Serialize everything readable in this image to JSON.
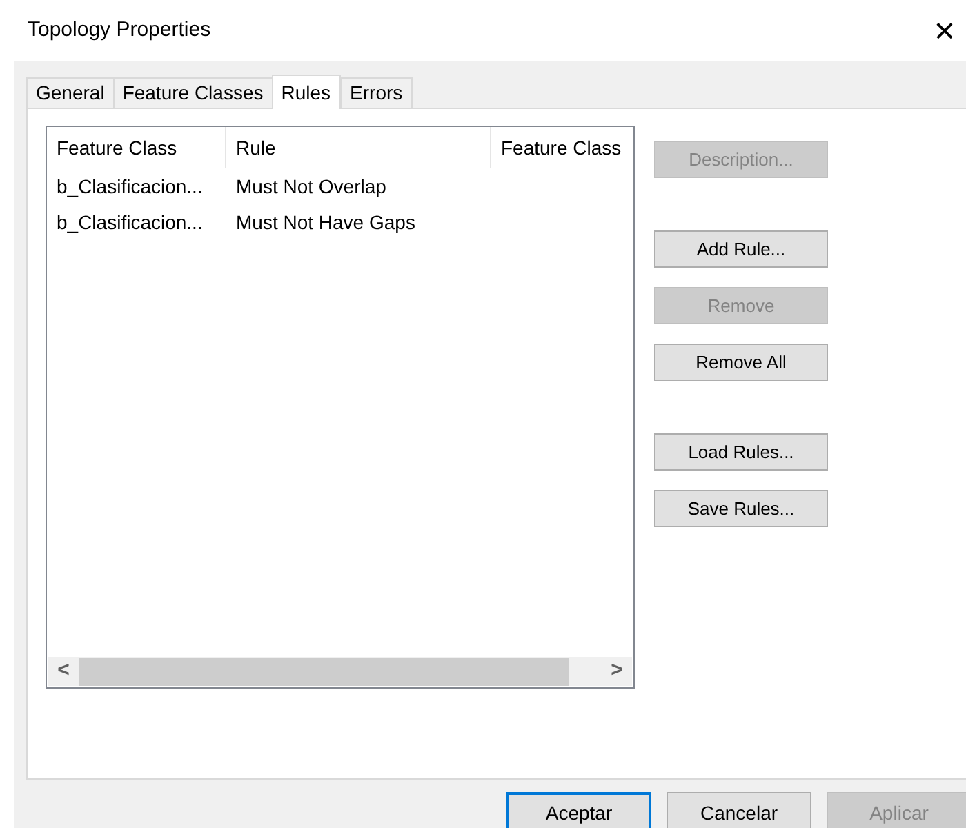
{
  "window": {
    "title": "Topology Properties",
    "close": "×"
  },
  "tabs": [
    {
      "label": "General",
      "selected": false
    },
    {
      "label": "Feature Classes",
      "selected": false
    },
    {
      "label": "Rules",
      "selected": true
    },
    {
      "label": "Errors",
      "selected": false
    }
  ],
  "table": {
    "columns": [
      "Feature Class",
      "Rule",
      "Feature Class"
    ],
    "rows": [
      [
        "b_Clasificacion...",
        "Must Not Overlap",
        ""
      ],
      [
        "b_Clasificacion...",
        "Must Not Have Gaps",
        ""
      ]
    ],
    "scroll_left": "<",
    "scroll_right": ">"
  },
  "side_button_groups": [
    [
      {
        "label": "Description...",
        "disabled": true
      }
    ],
    [
      {
        "label": "Add Rule...",
        "disabled": false
      },
      {
        "label": "Remove",
        "disabled": true
      },
      {
        "label": "Remove All",
        "disabled": false
      }
    ],
    [
      {
        "label": "Load Rules...",
        "disabled": false
      },
      {
        "label": "Save Rules...",
        "disabled": false
      }
    ]
  ],
  "dialog_buttons": [
    {
      "label": "Aceptar",
      "disabled": false,
      "default": true
    },
    {
      "label": "Cancelar",
      "disabled": false,
      "default": false
    },
    {
      "label": "Aplicar",
      "disabled": true,
      "default": false
    }
  ]
}
